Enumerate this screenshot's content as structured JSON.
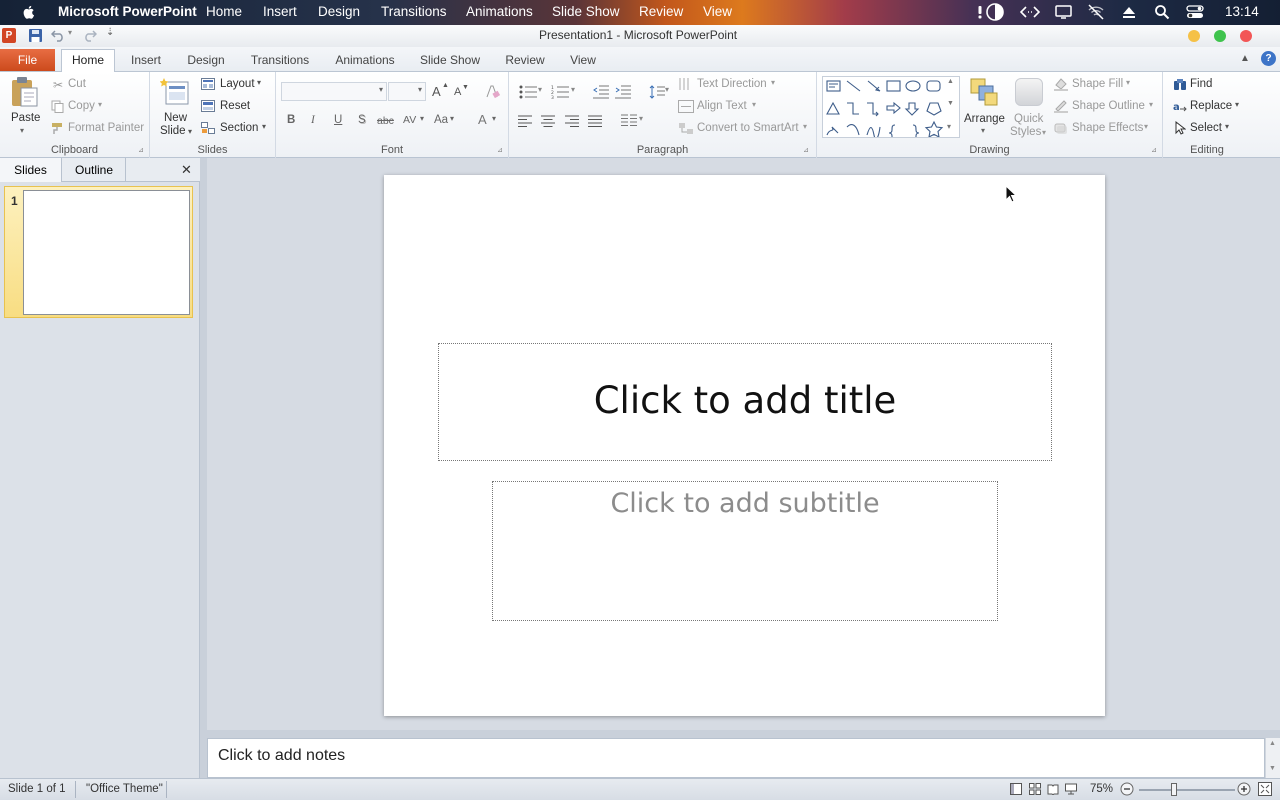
{
  "mac_menu": {
    "app_name": "Microsoft PowerPoint",
    "items": [
      "Home",
      "Insert",
      "Design",
      "Transitions",
      "Animations",
      "Slide Show",
      "Review",
      "View"
    ],
    "clock": "13:14"
  },
  "window": {
    "title": "Presentation1  -  Microsoft PowerPoint",
    "app_badge": "P"
  },
  "ribbon_tabs": {
    "file": "File",
    "tabs": [
      "Home",
      "Insert",
      "Design",
      "Transitions",
      "Animations",
      "Slide Show",
      "Review",
      "View"
    ],
    "active": "Home"
  },
  "clipboard": {
    "label": "Clipboard",
    "paste": "Paste",
    "cut": "Cut",
    "copy": "Copy",
    "format_painter": "Format Painter"
  },
  "slides_group": {
    "label": "Slides",
    "new_slide_line1": "New",
    "new_slide_line2": "Slide",
    "layout": "Layout",
    "reset": "Reset",
    "section": "Section"
  },
  "font": {
    "label": "Font",
    "bold": "B",
    "italic": "I",
    "underline": "U",
    "shadow": "S",
    "strike": "abc",
    "spacing": "AV",
    "case": "Aa",
    "grow": "A",
    "shrink": "A",
    "color": "A"
  },
  "paragraph": {
    "label": "Paragraph",
    "text_direction": "Text Direction",
    "align_text": "Align Text",
    "convert_smartart": "Convert to SmartArt"
  },
  "drawing": {
    "label": "Drawing",
    "arrange": "Arrange",
    "quick_styles_line1": "Quick",
    "quick_styles_line2": "Styles",
    "shape_fill": "Shape Fill",
    "shape_outline": "Shape Outline",
    "shape_effects": "Shape Effects"
  },
  "editing": {
    "label": "Editing",
    "find": "Find",
    "replace": "Replace",
    "select": "Select"
  },
  "panel": {
    "tab_slides": "Slides",
    "tab_outline": "Outline",
    "slide_number": "1"
  },
  "slide": {
    "title_placeholder": "Click to add title",
    "subtitle_placeholder": "Click to add subtitle"
  },
  "notes": {
    "placeholder": "Click to add notes"
  },
  "status": {
    "slide_info": "Slide 1 of 1",
    "theme": "\"Office Theme\"",
    "zoom": "75%",
    "zoom_fraction": 0.75
  },
  "colors": {
    "file_tab": "#d4542a",
    "accent_selected": "#f7d56a",
    "traffic_yellow": "#f5c147",
    "traffic_green": "#3fc34d",
    "traffic_red": "#f25656"
  }
}
